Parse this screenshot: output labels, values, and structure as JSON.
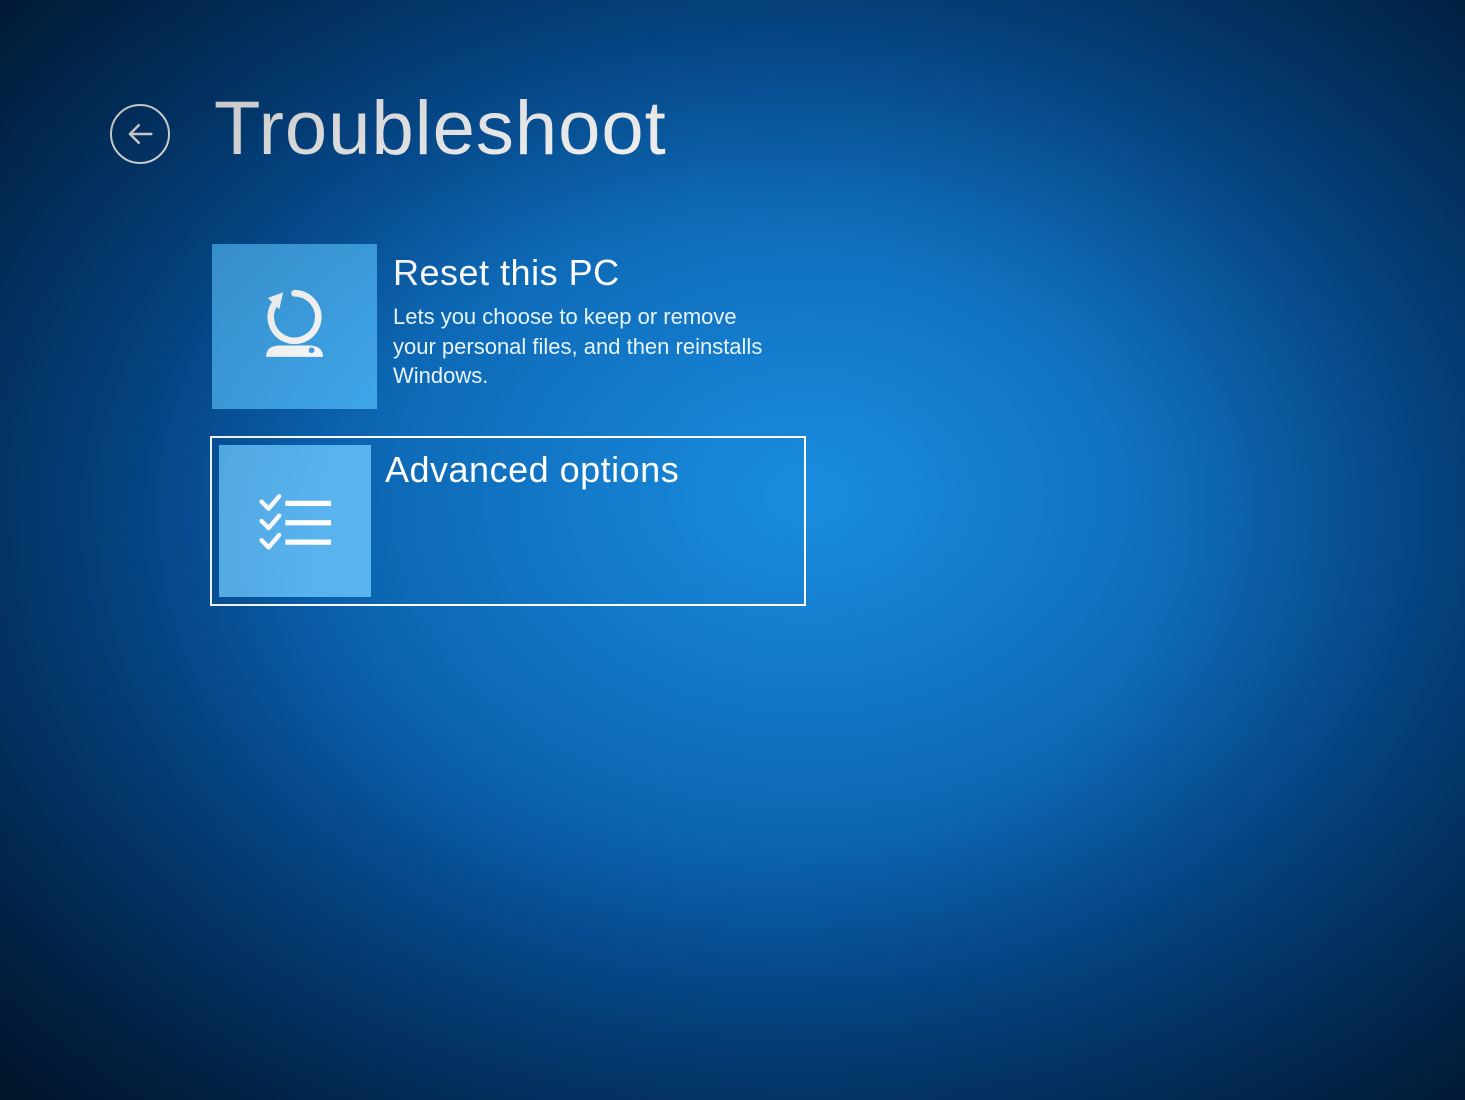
{
  "header": {
    "title": "Troubleshoot"
  },
  "options": [
    {
      "title": "Reset this PC",
      "description": "Lets you choose to keep or remove your personal files, and then reinstalls Windows.",
      "selected": false,
      "icon": "reset-icon"
    },
    {
      "title": "Advanced options",
      "description": "",
      "selected": true,
      "icon": "checklist-icon"
    }
  ],
  "colors": {
    "tile_bg": "#3fa4e8",
    "tile_bg_selected": "#58b3ef",
    "text": "#ffffff"
  }
}
